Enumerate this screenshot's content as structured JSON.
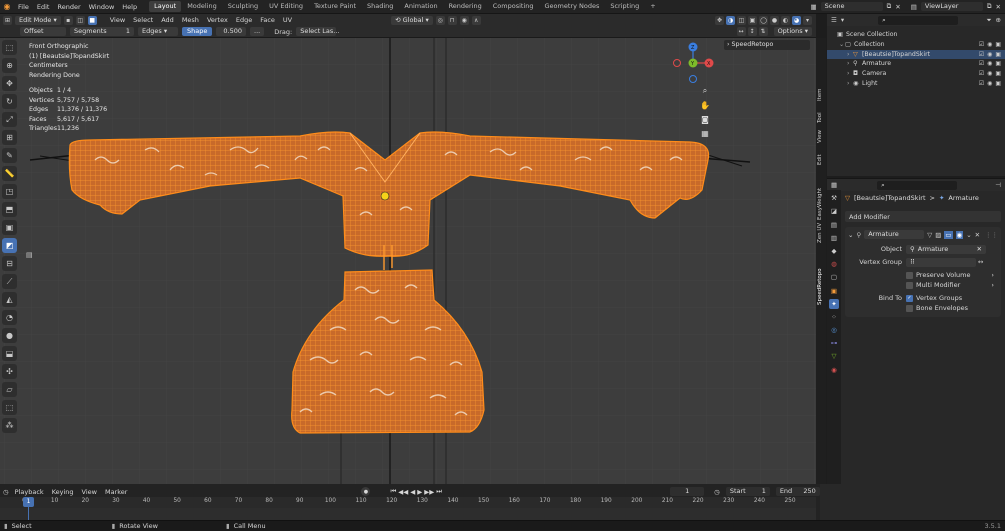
{
  "menu": [
    "File",
    "Edit",
    "Render",
    "Window",
    "Help"
  ],
  "workspaces": [
    {
      "label": "Layout",
      "active": true
    },
    {
      "label": "Modeling"
    },
    {
      "label": "Sculpting"
    },
    {
      "label": "UV Editing"
    },
    {
      "label": "Texture Paint"
    },
    {
      "label": "Shading"
    },
    {
      "label": "Animation"
    },
    {
      "label": "Rendering"
    },
    {
      "label": "Compositing"
    },
    {
      "label": "Geometry Nodes"
    },
    {
      "label": "Scripting"
    }
  ],
  "add_workspace": "+",
  "scene": {
    "label": "Scene",
    "view_layer": "ViewLayer"
  },
  "header": {
    "mode": "Edit Mode",
    "menus": [
      "View",
      "Select",
      "Add",
      "Mesh",
      "Vertex",
      "Edge",
      "Face",
      "UV"
    ],
    "orientation": "Global"
  },
  "toolsettings": {
    "offset": "Offset",
    "segments_label": "Segments",
    "segments_value": "1",
    "edges": "Edges",
    "shape_label": "Shape",
    "shape_value": "0.500",
    "dots": "...",
    "drag_label": "Drag:",
    "drag_value": "Select Las...",
    "options": "Options"
  },
  "overlay_text": {
    "view": "Front Orthographic",
    "object": "(1) [Beautsie]TopandSkirt",
    "units": "Centimeters",
    "render": "Rendering Done",
    "stats": [
      {
        "label": "Objects",
        "value": "1 / 4"
      },
      {
        "label": "Vertices",
        "value": "5,757 / 5,758"
      },
      {
        "label": "Edges",
        "value": "11,376 / 11,376"
      },
      {
        "label": "Faces",
        "value": "5,617 / 5,617"
      },
      {
        "label": "Triangles",
        "value": "11,236"
      }
    ]
  },
  "speedretopo_panel": "SpeedRetopo",
  "gizmo": {
    "x": "X",
    "y": "Y",
    "z": "Z"
  },
  "side_tabs": [
    "Item",
    "Tool",
    "View",
    "Edit",
    "EasyWeight",
    "Zen UV",
    "SpeedRetopo"
  ],
  "outliner": {
    "rows": [
      {
        "label": "Scene Collection",
        "indent": 0
      },
      {
        "label": "Collection",
        "indent": 1
      },
      {
        "label": "[Beautsie]TopandSkirt",
        "indent": 2,
        "selected": true
      },
      {
        "label": "Armature",
        "indent": 2
      },
      {
        "label": "Camera",
        "indent": 2
      },
      {
        "label": "Light",
        "indent": 2
      }
    ]
  },
  "properties": {
    "breadcrumb_object": "[Beautsie]TopandSkirt",
    "breadcrumb_sep": ">",
    "breadcrumb_modifier": "Armature",
    "add_modifier": "Add Modifier",
    "modifier_name": "Armature",
    "object_label": "Object",
    "object_value": "Armature",
    "vertex_group_label": "Vertex Group",
    "preserve_volume": "Preserve Volume",
    "multi_modifier": "Multi Modifier",
    "bind_to_label": "Bind To",
    "vertex_groups": "Vertex Groups",
    "vertex_groups_checked": true,
    "bone_envelopes": "Bone Envelopes"
  },
  "timeline": {
    "menus": [
      "Playback",
      "Keying",
      "View",
      "Marker"
    ],
    "current_frame": "1",
    "start_label": "Start",
    "start": "1",
    "end_label": "End",
    "end": "250",
    "ticks": [
      0,
      10,
      20,
      30,
      40,
      50,
      60,
      70,
      80,
      90,
      100,
      110,
      120,
      130,
      140,
      150,
      160,
      170,
      180,
      190,
      200,
      210,
      220,
      230,
      240,
      250
    ],
    "playhead": "1"
  },
  "statusbar": {
    "select": "Select",
    "rotate": "Rotate View",
    "menu": "Call Menu",
    "version": "3.5.1"
  },
  "colors": {
    "accent": "#4772b3",
    "mesh": "#d9711e",
    "wire": "#ff8c1a",
    "selected_row": "#334a6b"
  }
}
